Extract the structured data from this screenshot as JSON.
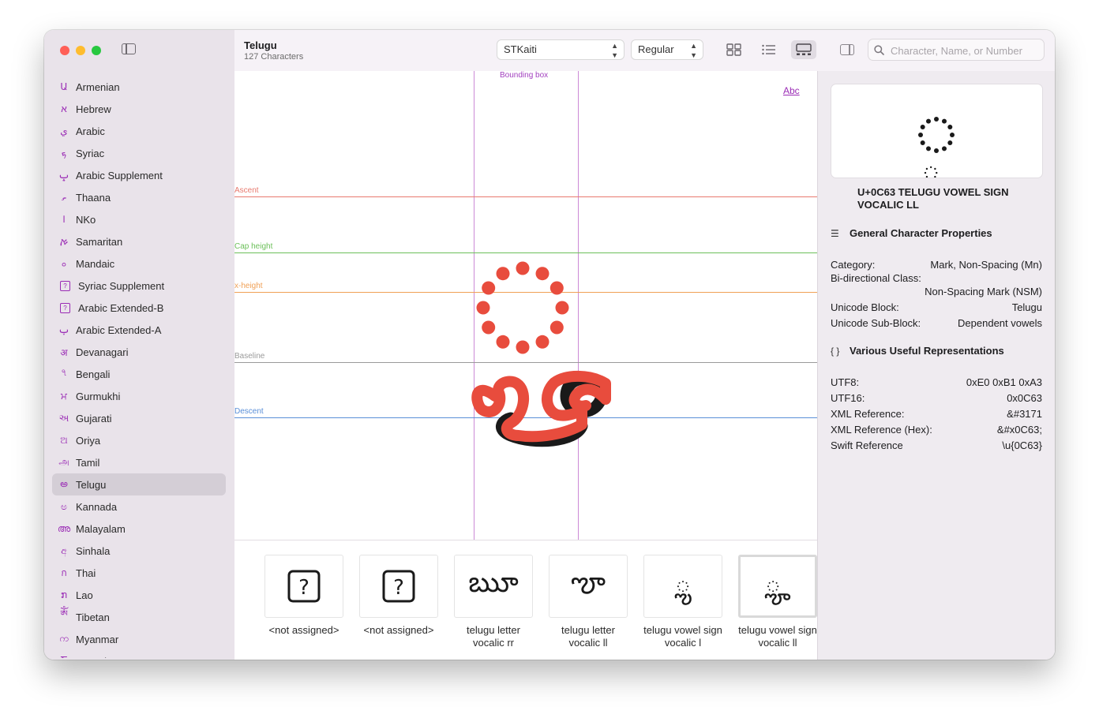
{
  "sidebar": {
    "items": [
      {
        "icon": "Ա",
        "label": "Armenian"
      },
      {
        "icon": "א",
        "label": "Hebrew"
      },
      {
        "icon": "ي",
        "label": "Arabic"
      },
      {
        "icon": "ܟ",
        "label": "Syriac"
      },
      {
        "icon": "ݒ",
        "label": "Arabic Supplement"
      },
      {
        "icon": "ތ",
        "label": "Thaana"
      },
      {
        "icon": "ߊ",
        "label": "NKo"
      },
      {
        "icon": "ࠀ",
        "label": "Samaritan"
      },
      {
        "icon": "ࡀ",
        "label": "Mandaic"
      },
      {
        "icon": "?",
        "label": "Syriac Supplement",
        "box": true
      },
      {
        "icon": "?",
        "label": "Arabic Extended-B",
        "box": true
      },
      {
        "icon": "ࢠ",
        "label": "Arabic Extended-A"
      },
      {
        "icon": "अ",
        "label": "Devanagari"
      },
      {
        "icon": "৭",
        "label": "Bengali"
      },
      {
        "icon": "ਮ",
        "label": "Gurmukhi"
      },
      {
        "icon": "અ",
        "label": "Gujarati"
      },
      {
        "icon": "ଅ",
        "label": "Oriya"
      },
      {
        "icon": "அ",
        "label": "Tamil"
      },
      {
        "icon": "అ",
        "label": "Telugu",
        "selected": true
      },
      {
        "icon": "ಅ",
        "label": "Kannada"
      },
      {
        "icon": "അ",
        "label": "Malayalam"
      },
      {
        "icon": "අ",
        "label": "Sinhala"
      },
      {
        "icon": "ก",
        "label": "Thai"
      },
      {
        "icon": "ກ",
        "label": "Lao"
      },
      {
        "icon": "ༀ",
        "label": "Tibetan"
      },
      {
        "icon": "က",
        "label": "Myanmar"
      },
      {
        "icon": "Ⴀ",
        "label": "Georgian"
      }
    ]
  },
  "toolbar": {
    "title": "Telugu",
    "subtitle": "127 Characters",
    "font_value": "STKaiti",
    "style_value": "Regular",
    "search_placeholder": "Character, Name, or Number"
  },
  "glyph_view": {
    "bounding_box_label": "Bounding box",
    "abc_label": "Abc",
    "metrics": [
      {
        "name": "ascent",
        "label": "Ascent",
        "color": "#e87a6f"
      },
      {
        "name": "cap-height",
        "label": "Cap height",
        "color": "#6cc05a"
      },
      {
        "name": "x-height",
        "label": "x-height",
        "color": "#f0a055"
      },
      {
        "name": "baseline",
        "label": "Baseline",
        "color": "#9a9a9a"
      },
      {
        "name": "descent",
        "label": "Descent",
        "color": "#5a8fd8"
      }
    ],
    "glyph_color": "#e84c3d"
  },
  "strip": {
    "cells": [
      {
        "type": "notdef",
        "label": "<not assigned>"
      },
      {
        "type": "notdef",
        "label": "<not assigned>"
      },
      {
        "type": "glyph",
        "char": "ౠ",
        "label": "telugu letter vocalic rr"
      },
      {
        "type": "glyph",
        "char": "ౡ",
        "label": "telugu letter vocalic ll"
      },
      {
        "type": "glyph",
        "char": "◌ౢ",
        "label": "telugu vowel sign vocalic l"
      },
      {
        "type": "glyph",
        "char": "◌ౣ",
        "label": "telugu vowel sign vocalic ll",
        "selected": true
      }
    ]
  },
  "inspector": {
    "char_name": "U+0C63 TELUGU VOWEL SIGN VOCALIC LL",
    "general_heading": "General Character Properties",
    "category_label": "Category:",
    "category_value": "Mark, Non-Spacing (Mn)",
    "bidi_label": "Bi-directional Class:",
    "bidi_value": "Non-Spacing Mark (NSM)",
    "block_label": "Unicode Block:",
    "block_value": "Telugu",
    "subblock_label": "Unicode Sub-Block:",
    "subblock_value": "Dependent vowels",
    "repr_heading": "Various Useful Representations",
    "utf8_label": "UTF8:",
    "utf8_value": "0xE0 0xB1 0xA3",
    "utf16_label": "UTF16:",
    "utf16_value": "0x0C63",
    "xml_label": "XML Reference:",
    "xml_value": "&#3171",
    "xmlhex_label": "XML Reference (Hex):",
    "xmlhex_value": "&#x0C63;",
    "swift_label": "Swift Reference",
    "swift_value": "\\u{0C63}"
  }
}
